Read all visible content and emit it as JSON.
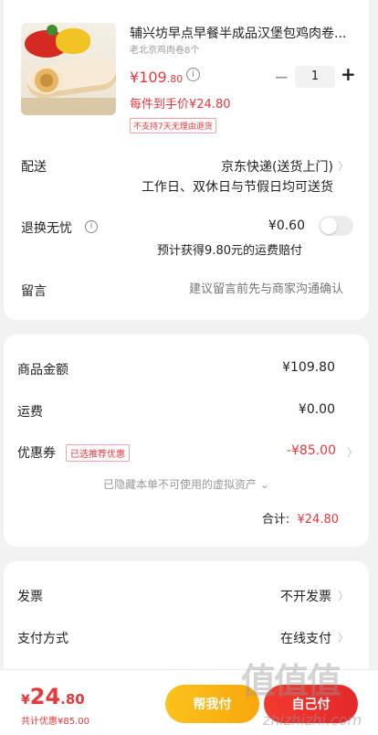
{
  "product": {
    "title": "辅兴坊早点早餐半成品汉堡包鸡肉卷...",
    "spec": "老北京鸡肉卷8个",
    "price_symbol": "¥",
    "price_int": "109",
    "price_dec": ".80",
    "info_icon": "i",
    "quantity": "1",
    "minus": "−",
    "plus": "+",
    "per_price": "每件到手价¥24.80",
    "notice": "不支持7天无理由退货"
  },
  "delivery": {
    "label": "配送",
    "value": "京东快递(送货上门)",
    "note": "工作日、双休日与节假日均可送货"
  },
  "return_service": {
    "label": "退换无忧",
    "help_icon": "i",
    "price": "¥0.60",
    "note": "预计获得9.80元的运费赔付",
    "enabled": false
  },
  "message": {
    "label": "留言",
    "placeholder": "建议留言前先与商家沟通确认"
  },
  "summary": {
    "goods_label": "商品金额",
    "goods_value": "¥109.80",
    "shipping_label": "运费",
    "shipping_value": "¥0.00",
    "coupon_label": "优惠券",
    "coupon_tag": "已选推荐优惠",
    "coupon_value": "-¥85.00",
    "hidden_note": "已隐藏本单不可使用的虚拟资产",
    "hidden_chevron": "⌄",
    "total_label": "合计:",
    "total_value": "¥24.80"
  },
  "invoice": {
    "label": "发票",
    "value": "不开发票"
  },
  "payment_method": {
    "label": "支付方式",
    "value": "在线支付"
  },
  "chevron": "〉",
  "bottom": {
    "currency": "¥",
    "amount_int": "24",
    "amount_dec": ".80",
    "saved": "共计优惠¥85.00",
    "help_button": "帮我付",
    "pay_button": "自己付"
  },
  "watermark": {
    "logo": "值值值",
    "site": "zhizhizhi.com"
  },
  "colors": {
    "accent": "#e4393c",
    "help_button": "#f9b417",
    "pay_button": "#e4282b"
  }
}
